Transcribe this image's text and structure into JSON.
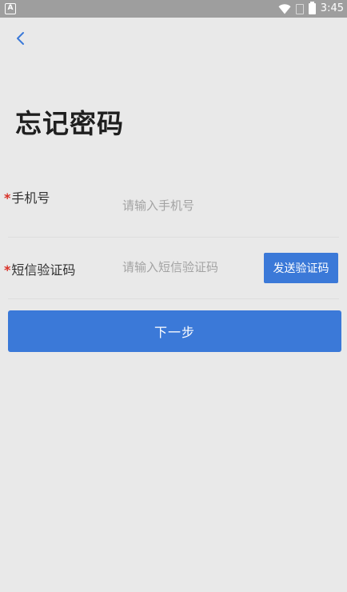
{
  "status_bar": {
    "app_icon_letter": "A",
    "time": "3:45",
    "icons": [
      "wifi-icon",
      "sim-icon",
      "battery-icon"
    ]
  },
  "header": {
    "back_icon": "chevron-left-icon"
  },
  "page": {
    "title": "忘记密码"
  },
  "form": {
    "phone": {
      "required_mark": "*",
      "label": "手机号",
      "placeholder": "请输入手机号",
      "value": ""
    },
    "sms_code": {
      "required_mark": "*",
      "label": "短信验证码",
      "placeholder": "请输入短信验证码",
      "value": "",
      "send_button_label": "发送验证码"
    },
    "next_button_label": "下一步"
  },
  "colors": {
    "primary": "#3b79d8",
    "background": "#e9e9e9",
    "required": "#d93026",
    "status_bar": "#9e9e9e"
  }
}
